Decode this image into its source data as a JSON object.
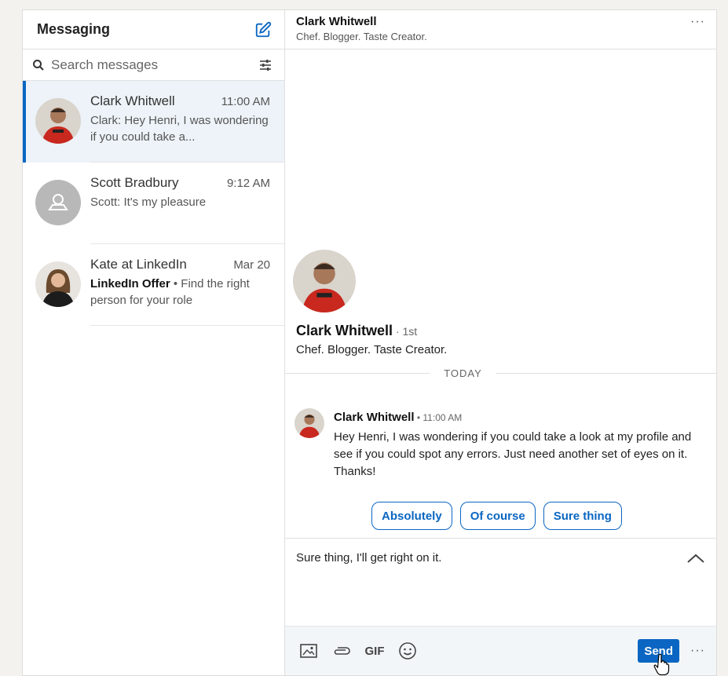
{
  "sidebar": {
    "title": "Messaging",
    "search_placeholder": "Search messages",
    "conversations": [
      {
        "name": "Clark Whitwell",
        "time": "11:00 AM",
        "snippet": "Clark: Hey Henri, I was wondering if you could take a..."
      },
      {
        "name": "Scott Bradbury",
        "time": "9:12 AM",
        "snippet": "Scott: It's my pleasure"
      },
      {
        "name": "Kate at LinkedIn",
        "time": "Mar 20",
        "snippet_bold": "LinkedIn Offer",
        "snippet_sep": " • ",
        "snippet": "Find the right person for your role"
      }
    ]
  },
  "header": {
    "name": "Clark Whitwell",
    "subtitle": "Chef. Blogger. Taste Creator.",
    "more": "···"
  },
  "profile": {
    "name": "Clark Whitwell",
    "degree": " · 1st",
    "headline": "Chef. Blogger. Taste Creator."
  },
  "thread": {
    "divider": "TODAY",
    "message": {
      "sender": "Clark Whitwell",
      "time": " • 11:00 AM",
      "text": "Hey Henri, I was wondering if you could take a look at my profile and see if you could spot any errors. Just need another set of eyes on it. Thanks!"
    },
    "smart_replies": [
      "Absolutely",
      "Of course",
      "Sure thing"
    ]
  },
  "composer": {
    "text": "Sure thing, I'll get right on it.",
    "gif_label": "GIF",
    "send_label": "Send",
    "more": "···"
  },
  "colors": {
    "accent": "#0a66c2",
    "active_bg": "#edf3f8"
  },
  "icons": [
    "compose-icon",
    "search-icon",
    "filter-icon",
    "image-icon",
    "attachment-icon",
    "emoji-icon",
    "chevron-up-icon",
    "hand-cursor-icon"
  ]
}
